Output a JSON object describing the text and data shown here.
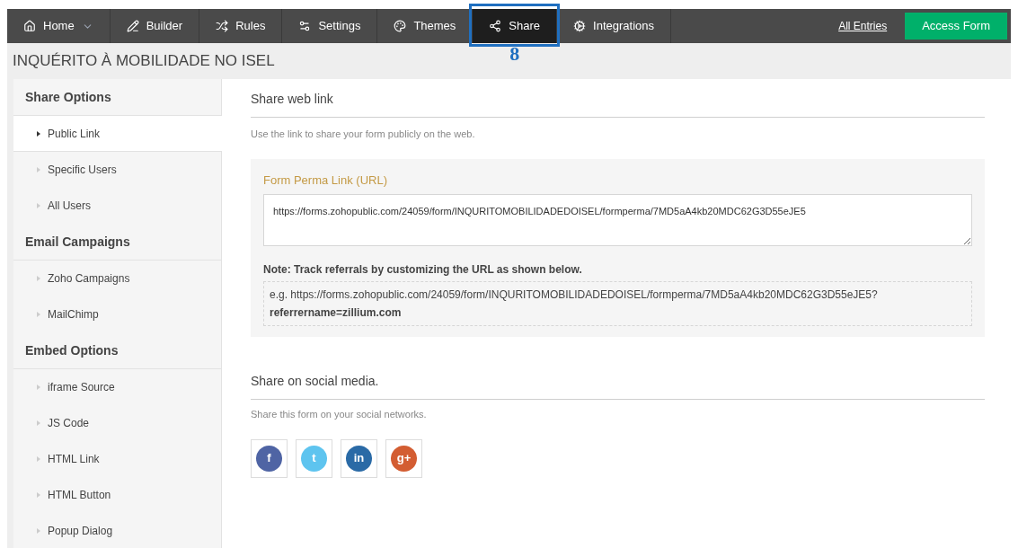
{
  "nav": {
    "tabs": [
      {
        "label": "Home",
        "kind": "home",
        "dropdown": true,
        "selected": false
      },
      {
        "label": "Builder",
        "kind": "builder",
        "dropdown": false,
        "selected": false
      },
      {
        "label": "Rules",
        "kind": "rules",
        "dropdown": false,
        "selected": false
      },
      {
        "label": "Settings",
        "kind": "settings",
        "dropdown": false,
        "selected": false
      },
      {
        "label": "Themes",
        "kind": "themes",
        "dropdown": false,
        "selected": false
      },
      {
        "label": "Share",
        "kind": "share",
        "dropdown": false,
        "selected": true
      },
      {
        "label": "Integrations",
        "kind": "integrations",
        "dropdown": false,
        "selected": false
      }
    ],
    "link": "All Entries",
    "button": "Access Form"
  },
  "annotation": {
    "label": "8"
  },
  "form_title": "INQUÉRITO À MOBILIDADE NO ISEL",
  "sidebar": [
    {
      "heading": "Share Options",
      "items": [
        {
          "label": "Public Link",
          "selected": true
        },
        {
          "label": "Specific Users",
          "selected": false
        },
        {
          "label": "All Users",
          "selected": false
        }
      ]
    },
    {
      "heading": "Email Campaigns",
      "items": [
        {
          "label": "Zoho Campaigns",
          "selected": false
        },
        {
          "label": "MailChimp",
          "selected": false
        }
      ]
    },
    {
      "heading": "Embed Options",
      "items": [
        {
          "label": "iframe Source",
          "selected": false
        },
        {
          "label": "JS Code",
          "selected": false
        },
        {
          "label": "HTML Link",
          "selected": false
        },
        {
          "label": "HTML Button",
          "selected": false
        },
        {
          "label": "Popup Dialog",
          "selected": false
        }
      ]
    }
  ],
  "web_link": {
    "title": "Share web link",
    "description": "Use the link to share your form publicly on the web.",
    "field_label": "Form Perma Link (URL)",
    "url": "https://forms.zohopublic.com/24059/form/INQURITOMOBILIDADEDOISEL/formperma/7MD5aA4kb20MDC62G3D55eJE5",
    "note": "Note: Track referrals by customizing the URL as shown below.",
    "example": "e.g. https://forms.zohopublic.com/24059/form/INQURITOMOBILIDADEDOISEL/formperma/7MD5aA4kb20MDC62G3D55eJE5?\n**referrername=zillium.com**"
  },
  "social": {
    "title": "Share on social media.",
    "description": "Share this form on your social networks.",
    "networks": [
      {
        "glyph": "f",
        "color": "#4f64a4"
      },
      {
        "glyph": "t",
        "color": "#5ec4ef"
      },
      {
        "glyph": "in",
        "color": "#2a6aa6"
      },
      {
        "glyph": "g+",
        "color": "#d35d32"
      }
    ]
  }
}
